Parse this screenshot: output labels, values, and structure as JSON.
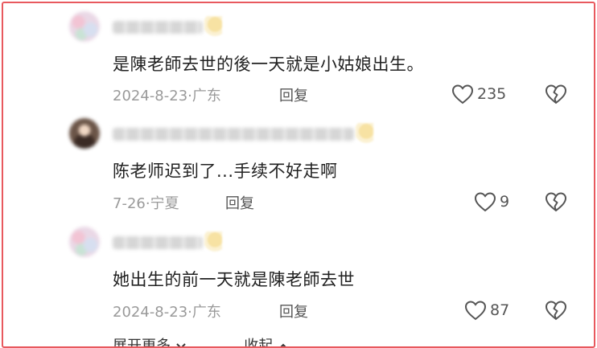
{
  "comments": [
    {
      "text": "是陳老師去世的後一天就是小姑娘出生。",
      "date": "2024-8-23",
      "location": "广东",
      "reply_label": "回复",
      "likes": "235",
      "avatar": "pastel-avatar",
      "username_redacted": true
    },
    {
      "text": "陈老师迟到了...手续不好走啊",
      "date": "7-26",
      "location": "宁夏",
      "reply_label": "回复",
      "likes": "9",
      "avatar": "dark-avatar",
      "username_redacted": true
    },
    {
      "text": "她出生的前一天就是陳老師去世",
      "date": "2024-8-23",
      "location": "广东",
      "reply_label": "回复",
      "likes": "87",
      "avatar": "pastel-avatar",
      "username_redacted": true
    }
  ],
  "separator": "·",
  "footer": {
    "expand_label": "展开更多",
    "collapse_label": "收起"
  },
  "icons": {
    "like": "heart-outline-icon",
    "dislike": "broken-heart-icon",
    "expand": "chevron-down-icon",
    "collapse": "chevron-up-icon"
  },
  "colors": {
    "border": "#e8595e",
    "text": "#222222",
    "meta": "#9a9a9a",
    "icon": "#555555"
  }
}
